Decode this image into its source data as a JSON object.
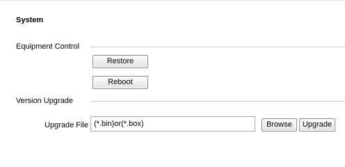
{
  "page": {
    "title": "System"
  },
  "equipment_control": {
    "label": "Equipment Control",
    "restore_label": "Restore",
    "reboot_label": "Reboot"
  },
  "version_upgrade": {
    "label": "Version Upgrade",
    "file_label": "Upgrade File",
    "file_placeholder": "(*.bin)or(*.box)",
    "browse_label": "Browse",
    "upgrade_label": "Upgrade"
  }
}
